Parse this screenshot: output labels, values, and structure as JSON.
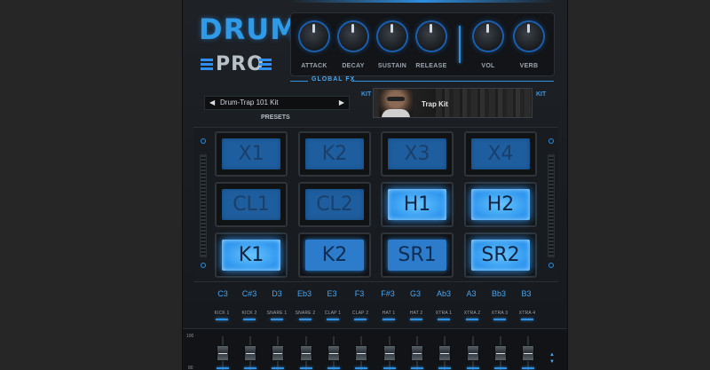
{
  "brand": {
    "title": "DRUM",
    "subtitle": "PRO"
  },
  "knobs": [
    {
      "label": "ATTACK"
    },
    {
      "label": "DECAY"
    },
    {
      "label": "SUSTAIN"
    },
    {
      "label": "RELEASE"
    },
    {
      "label": "VOL"
    },
    {
      "label": "VERB"
    }
  ],
  "global_fx_label": "GLOBAL FX",
  "preset": {
    "value": "Drum-Trap 101 Kit",
    "label": "PRESETS",
    "prev": "◀",
    "next": "▶"
  },
  "kit": {
    "side_left": "KIT",
    "side_right": "KIT",
    "name": "Trap Kit"
  },
  "pads": [
    {
      "label": "X1",
      "state": "dim"
    },
    {
      "label": "K2",
      "state": "dim"
    },
    {
      "label": "X3",
      "state": "dim"
    },
    {
      "label": "X4",
      "state": "dim"
    },
    {
      "label": "CL1",
      "state": "dim"
    },
    {
      "label": "CL2",
      "state": "dim"
    },
    {
      "label": "H1",
      "state": "lit"
    },
    {
      "label": "H2",
      "state": "lit"
    },
    {
      "label": "K1",
      "state": "lit"
    },
    {
      "label": "K2",
      "state": "mid"
    },
    {
      "label": "SR1",
      "state": "mid"
    },
    {
      "label": "SR2",
      "state": "lit"
    }
  ],
  "notes": [
    "C3",
    "C#3",
    "D3",
    "Eb3",
    "E3",
    "F3",
    "F#3",
    "G3",
    "Ab3",
    "A3",
    "Bb3",
    "B3"
  ],
  "channels": [
    "KICK 1",
    "KICK 2",
    "SNARE 1",
    "SNARE 2",
    "CLAP 1",
    "CLAP 2",
    "HAT 1",
    "HAT 2",
    "XTRA 1",
    "XTRA 2",
    "XTRA 3",
    "XTRA 4"
  ],
  "mixer": {
    "scale_top": "100",
    "scale_bottom": "80",
    "arrow_up": "▲",
    "arrow_down": "▼"
  },
  "colors": {
    "accent": "#2f8fe0",
    "panel": "#1a1d21",
    "pad_lit": "#3aa0ff"
  }
}
